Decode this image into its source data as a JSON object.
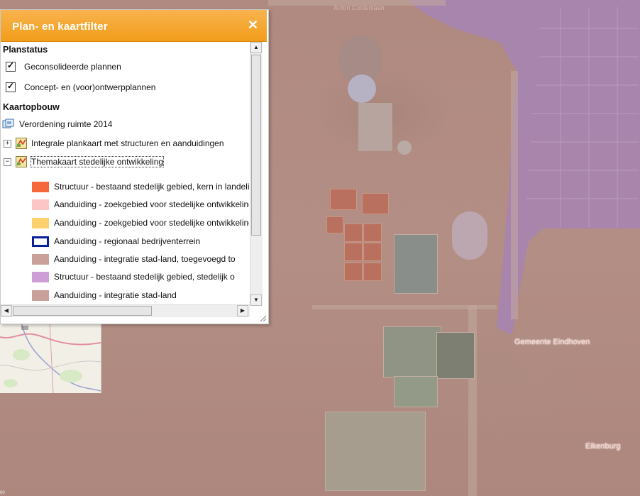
{
  "panel": {
    "title": "Plan- en kaartfilter",
    "close_icon": "close-icon"
  },
  "planstatus": {
    "heading": "Planstatus",
    "options": [
      {
        "label": "Geconsolideerde plannen",
        "checked": true
      },
      {
        "label": "Concept- en (voor)ontwerpplannen",
        "checked": true
      }
    ]
  },
  "kaartopbouw": {
    "heading": "Kaartopbouw",
    "root_label": "Verordening ruimte 2014",
    "layers": [
      {
        "label": "Integrale plankaart met structuren en aanduidingen",
        "expander": "+"
      },
      {
        "label": "Themakaart stedelijke ontwikkeling",
        "expander": "−"
      }
    ],
    "legend": [
      {
        "label": "Structuur - bestaand stedelijk gebied, kern in landelijk gebied",
        "color": "#f4683c",
        "style": "fill"
      },
      {
        "label": "Aanduiding - zoekgebied voor stedelijke ontwikkeling",
        "color": "#fcc6c6",
        "style": "fill"
      },
      {
        "label": "Aanduiding - zoekgebied voor stedelijke ontwikkeling",
        "color": "#fdd16e",
        "style": "fill"
      },
      {
        "label": "Aanduiding - regionaal bedrijventerrein",
        "color": "#0a1f9a",
        "style": "outline"
      },
      {
        "label": "Aanduiding - integratie stad-land, toegevoegd to",
        "color": "#c9a09a",
        "style": "fill"
      },
      {
        "label": "Structuur - bestaand stedelijk gebied, stedelijk o",
        "color": "#cd9fd6",
        "style": "fill"
      },
      {
        "label": "Aanduiding - integratie stad-land",
        "color": "#c9a09a",
        "style": "fill"
      }
    ]
  },
  "map": {
    "labels": {
      "gemeente": "Gemeente Eindhoven",
      "place": "Eikenburg",
      "street_top": "Anton Coolenlaan"
    },
    "scale_text": "00"
  }
}
